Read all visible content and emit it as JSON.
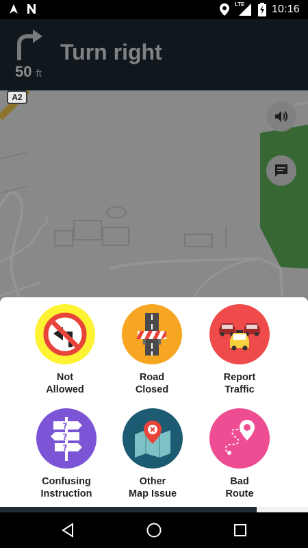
{
  "status_bar": {
    "time": "10:16",
    "network_label": "LTE",
    "icons": [
      "navigation-arrow-icon",
      "n-notification-icon",
      "location-pin-icon",
      "signal-icon",
      "battery-charging-icon"
    ]
  },
  "navigation": {
    "instruction": "Turn right",
    "distance_value": "50",
    "distance_unit": "ft",
    "turn_icon": "turn-right-arrow-icon"
  },
  "map": {
    "road_badge": "A2",
    "buttons": [
      {
        "name": "volume-button",
        "icon": "speaker-icon"
      },
      {
        "name": "report-button",
        "icon": "chat-bubble-icon"
      }
    ]
  },
  "report_menu": {
    "items": [
      {
        "line1": "Not",
        "line2": "Allowed",
        "color": "#fdf333",
        "icon": "no-left-turn-icon"
      },
      {
        "line1": "Road",
        "line2": "Closed",
        "color": "#f6a623",
        "icon": "road-barrier-icon"
      },
      {
        "line1": "Report",
        "line2": "Traffic",
        "color": "#ef4b4b",
        "icon": "traffic-cars-icon"
      },
      {
        "line1": "Confusing",
        "line2": "Instruction",
        "color": "#7b55d6",
        "icon": "question-signpost-icon"
      },
      {
        "line1": "Other",
        "line2": "Map Issue",
        "color": "#1d5b73",
        "icon": "map-error-pin-icon"
      },
      {
        "line1": "Bad",
        "line2": "Route",
        "color": "#ee4c93",
        "icon": "route-pin-icon"
      }
    ]
  },
  "colors": {
    "header_bg": "#1e2a36",
    "sheet_bg": "#ffffff",
    "map_green": "#5fb35a"
  }
}
